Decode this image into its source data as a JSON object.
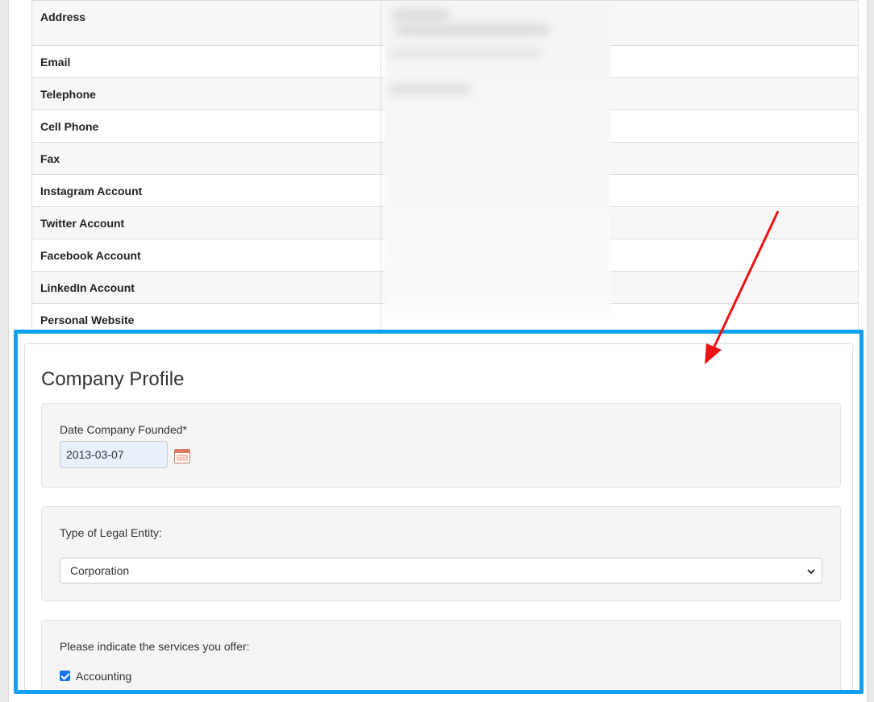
{
  "contact_table": {
    "rows": [
      {
        "label": "Address"
      },
      {
        "label": "Email"
      },
      {
        "label": "Telephone"
      },
      {
        "label": "Cell Phone"
      },
      {
        "label": "Fax"
      },
      {
        "label": "Instagram Account"
      },
      {
        "label": "Twitter Account"
      },
      {
        "label": "Facebook Account"
      },
      {
        "label": "LinkedIn Account"
      },
      {
        "label": "Personal Website"
      }
    ]
  },
  "company_profile": {
    "title": "Company Profile",
    "date_founded": {
      "label": "Date Company Founded*",
      "value": "2013-03-07",
      "icon": "calendar-icon"
    },
    "legal_entity": {
      "label": "Type of Legal Entity:",
      "selected": "Corporation",
      "icon": "chevron-down-icon"
    },
    "services": {
      "label": "Please indicate the services you offer:",
      "options": [
        {
          "label": "Accounting",
          "checked": true
        },
        {
          "label": "",
          "checked": false
        }
      ]
    }
  },
  "annotations": {
    "highlight_color": "#10a0ee",
    "arrow_color": "#ee1111"
  }
}
